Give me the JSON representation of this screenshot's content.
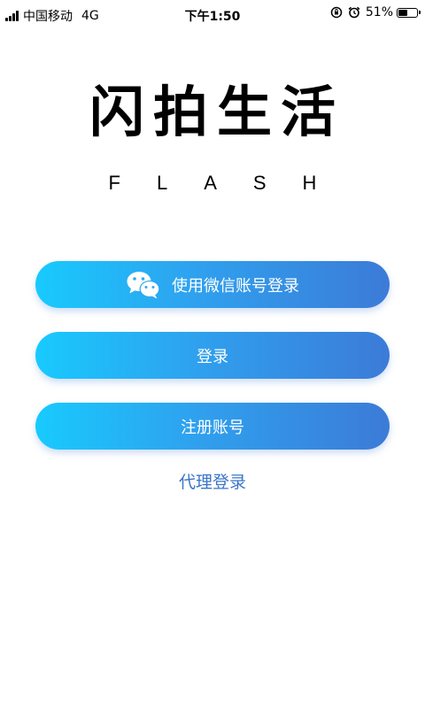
{
  "status_bar": {
    "carrier": "中国移动",
    "network": "4G",
    "time": "下午1:50",
    "battery_percent_label": "51%",
    "battery_level": 0.51
  },
  "logo": {
    "title": "闪拍生活",
    "subtitle": "FLASH"
  },
  "buttons": {
    "wechat_login": "使用微信账号登录",
    "login": "登录",
    "register": "注册账号"
  },
  "links": {
    "agent_login": "代理登录"
  },
  "colors": {
    "gradient_start": "#18cafe",
    "gradient_end": "#3c7bd8",
    "link": "#3a74c8"
  }
}
